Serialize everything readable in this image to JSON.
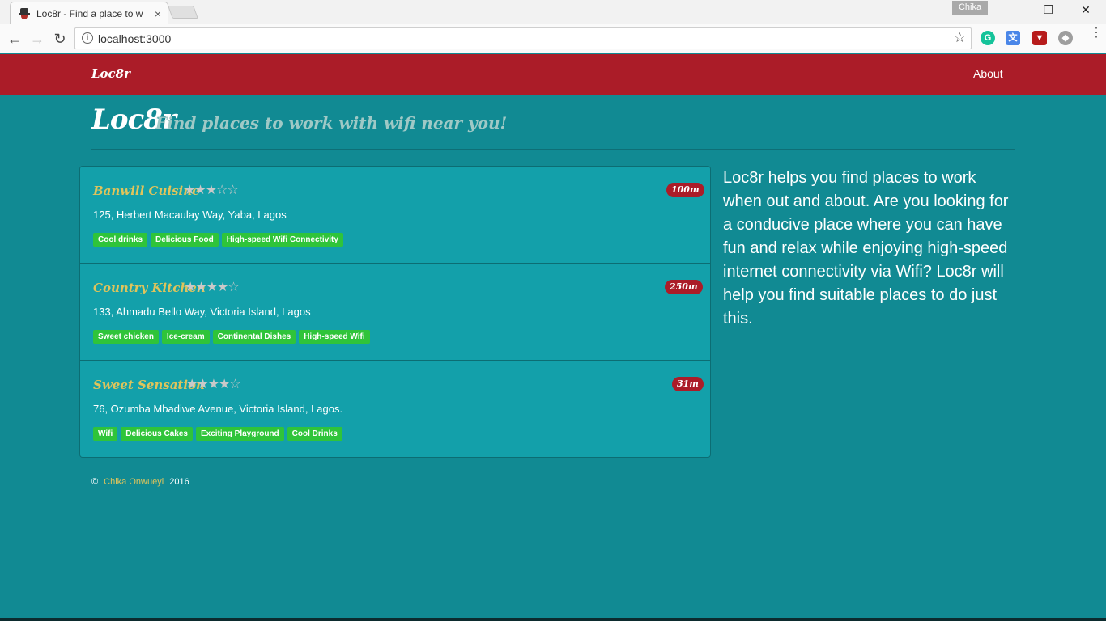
{
  "browser": {
    "tab_title": "Loc8r - Find a place to w",
    "tab_close": "×",
    "profile_name": "Chika",
    "url": "localhost:3000",
    "window_controls": [
      "–",
      "❐",
      "✕"
    ]
  },
  "navbar": {
    "brand": "Loc8r",
    "about": "About"
  },
  "header": {
    "title": "Loc8r",
    "subtitle": "Find places to work with wifi near you!"
  },
  "locations": [
    {
      "name": "Banwill Cuisine",
      "rating": 3,
      "stars": "★★★☆☆",
      "distance": "100m",
      "address": "125, Herbert Macaulay Way, Yaba, Lagos",
      "facilities": [
        "Cool drinks",
        "Delicious Food",
        "High-speed Wifi Connectivity"
      ]
    },
    {
      "name": "Country Kitchen",
      "rating": 4,
      "stars": "★★★★☆",
      "distance": "250m",
      "address": "133, Ahmadu Bello Way, Victoria Island, Lagos",
      "facilities": [
        "Sweet chicken",
        "Ice-cream",
        "Continental Dishes",
        "High-speed Wifi"
      ]
    },
    {
      "name": "Sweet Sensation",
      "rating": 4,
      "stars": "★★★★☆",
      "distance": "31m",
      "address": "76, Ozumba Mbadiwe Avenue, Victoria Island, Lagos.",
      "facilities": [
        "Wifi",
        "Delicious Cakes",
        "Exciting Playground",
        "Cool Drinks"
      ]
    }
  ],
  "sidebar": {
    "text": "Loc8r helps you find places to work when out and about. Are you looking for a conducive place where you can have fun and relax while enjoying high-speed internet connectivity via Wifi? Loc8r will help you find suitable places to do just this."
  },
  "footer": {
    "copyright": "©",
    "author": "Chika Onwueyi",
    "year": "2016"
  },
  "colors": {
    "navbar": "#ab1c28",
    "background": "#118a93",
    "panel": "#13a0aa",
    "tag": "#2fc43a",
    "accent": "#e0c45b"
  }
}
